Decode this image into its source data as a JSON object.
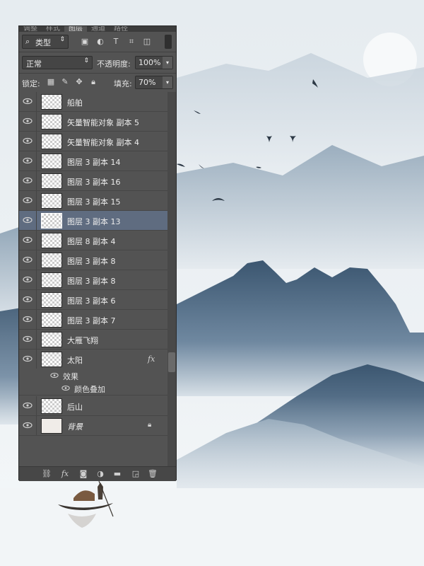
{
  "panel": {
    "tabs": [
      "调整",
      "样式",
      "图层",
      "通道",
      "路径"
    ],
    "filter": {
      "label": "类型"
    },
    "blend_mode": "正常",
    "opacity_label": "不透明度:",
    "opacity_value": "100%",
    "lock_label": "锁定:",
    "fill_label": "填充:",
    "fill_value": "70%",
    "layers": [
      {
        "name": "船舶"
      },
      {
        "name": "矢量智能对象 副本 5"
      },
      {
        "name": "矢量智能对象 副本 4"
      },
      {
        "name": "图层 3 副本 14"
      },
      {
        "name": "图层 3 副本 16"
      },
      {
        "name": "图层 3 副本 15"
      },
      {
        "name": "图层 3 副本 13",
        "selected": true
      },
      {
        "name": "图层 8 副本 4"
      },
      {
        "name": "图层 3 副本 8"
      },
      {
        "name": "图层 3 副本 8"
      },
      {
        "name": "图层 3 副本 6"
      },
      {
        "name": "图层 3 副本 7"
      },
      {
        "name": "大雁飞翔"
      },
      {
        "name": "太阳",
        "fx": "fx"
      },
      {
        "name": "后山"
      },
      {
        "name": "背景"
      }
    ],
    "effects_label": "效果",
    "effect_item": "颜色叠加"
  },
  "colors": {
    "sky": "#e9eef2",
    "mountain_dark": "#3e5a74",
    "mountain_mid": "#7d95aa",
    "panel_bg": "#535353",
    "selection": "#5f6c80"
  }
}
